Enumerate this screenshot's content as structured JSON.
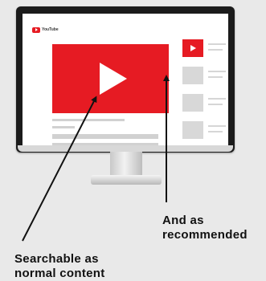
{
  "screen": {
    "brand": "YouTube"
  },
  "annotations": {
    "recommended": [
      "And as",
      "recommended"
    ],
    "searchable": [
      "Searchable as",
      "normal content"
    ]
  },
  "colors": {
    "background": "#e9e9e9",
    "youtube_red": "#e61b23",
    "placeholder_gray": "#d1d1d1",
    "bezel": "#1b1b1b"
  }
}
